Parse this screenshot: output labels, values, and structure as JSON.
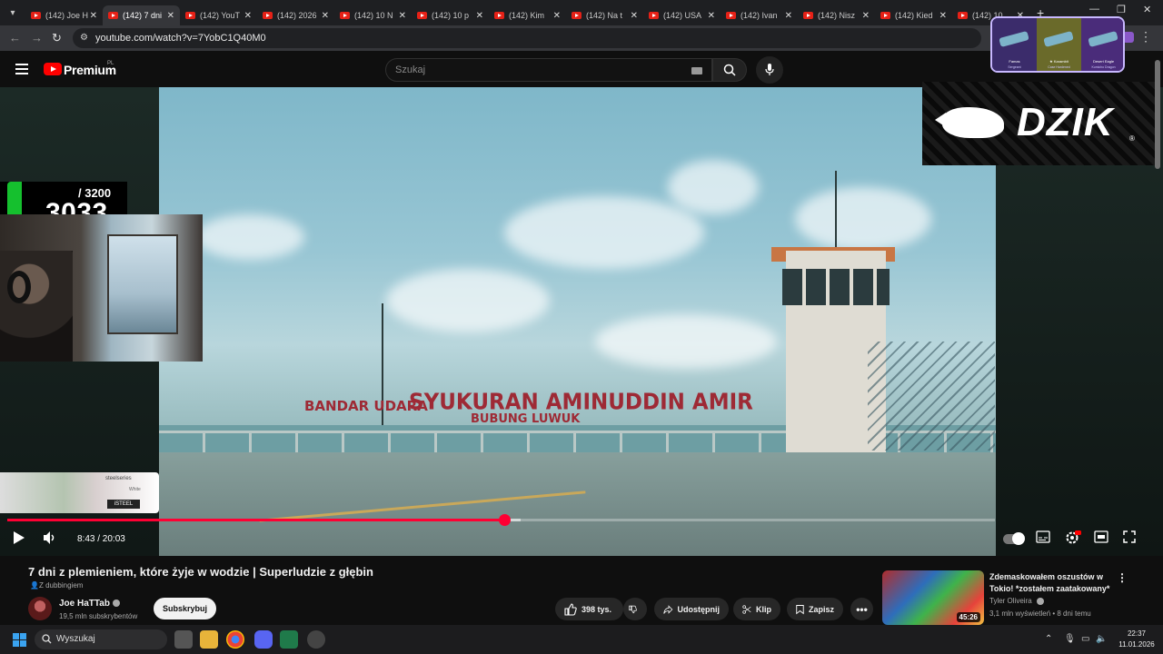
{
  "browser": {
    "tabs": [
      {
        "label": "(142) Joe H",
        "active": false
      },
      {
        "label": "(142) 7 dni",
        "active": true
      },
      {
        "label": "(142) YouT",
        "active": false
      },
      {
        "label": "(142) 2026",
        "active": false
      },
      {
        "label": "(142) 10 N",
        "active": false
      },
      {
        "label": "(142) 10 p",
        "active": false
      },
      {
        "label": "(142) Kim",
        "active": false
      },
      {
        "label": "(142) Na t",
        "active": false
      },
      {
        "label": "(142) USA",
        "active": false
      },
      {
        "label": "(142) Ivan",
        "active": false
      },
      {
        "label": "(142) Nisz",
        "active": false
      },
      {
        "label": "(142) Kied",
        "active": false
      },
      {
        "label": "(142) 10",
        "active": false
      }
    ],
    "url": "youtube.com/watch?v=7YobC1Q40M0"
  },
  "youtube": {
    "brand": "Premium",
    "country": "PL",
    "search_placeholder": "Szukaj"
  },
  "video": {
    "sign_small": "BANDAR UDARA",
    "sign_large": "SYUKURAN AMINUDDIN AMIR",
    "sign_sub": "BUBUNG LUWUK",
    "counter_total": "/ 3200",
    "counter_value": "3033",
    "sponsor_brand": "DZIK",
    "sponsor_reg": "®",
    "steelseries_logo": "steelseries",
    "steelseries_white": "White",
    "steelseries_tag": "iSTEEL",
    "skins": [
      {
        "name": "Famas",
        "sub": "Sergeant"
      },
      {
        "name": "★ Karambit",
        "sub": "Case Hardened"
      },
      {
        "name": "Desert Eagle",
        "sub": "Kumicho Dragon"
      }
    ],
    "current_time": "8:43",
    "duration": "20:03",
    "time_display": "8:43 / 20:03",
    "progress_fraction": 0.503,
    "buffer_fraction": 0.52
  },
  "meta": {
    "title": "7 dni z plemieniem, które żyje w wodzie | Superludzie z głębin",
    "dubbing": "Z dubbingiem",
    "channel": "Joe HaTTab",
    "subscribers": "19,5 mln subskrybentów",
    "subscribe_label": "Subskrybuj",
    "likes": "398 tys.",
    "share_label": "Udostępnij",
    "clip_label": "Klip",
    "save_label": "Zapisz"
  },
  "recommendation": {
    "title": "Zdemaskowałem oszustów w Tokio! *zostałem zaatakowany*",
    "channel": "Tyler Oliveira",
    "meta": "3,1 mln wyświetleń • 8 dni temu",
    "duration": "45:26"
  },
  "taskbar": {
    "search_label": "Wyszukaj",
    "time": "22:37",
    "date": "11.01.2026"
  },
  "colors": {
    "progress": "#ff0033",
    "yt_red": "#ff0000",
    "bg": "#0f0f0f"
  }
}
